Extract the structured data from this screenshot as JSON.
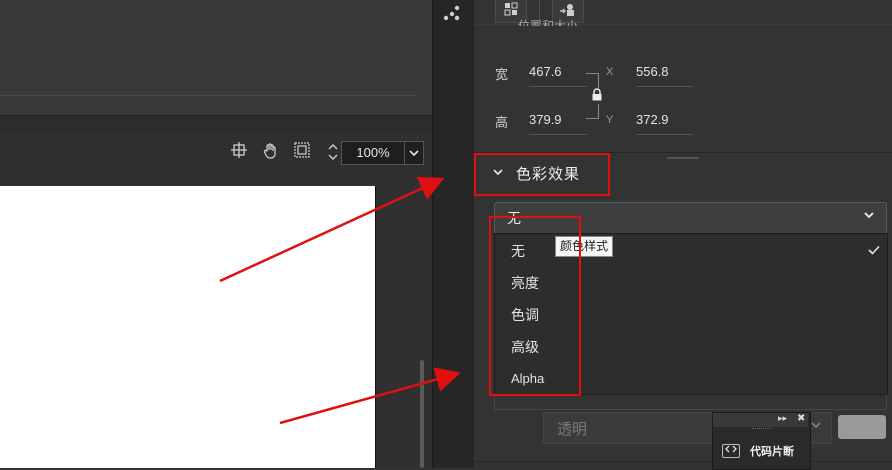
{
  "stage": {
    "zoom_value": "100%",
    "tool_icons": [
      "crosshair-icon",
      "hand-icon",
      "clip-icon",
      "vertical-resize-icon"
    ]
  },
  "properties": {
    "top_buttons": [
      "align-icon",
      "transform-icon"
    ],
    "section_title_partial": "位置和大小",
    "size": {
      "width_label": "宽",
      "width_value": "467.6",
      "height_label": "高",
      "height_value": "379.9",
      "x_label": "X",
      "x_value": "556.8",
      "y_label": "Y",
      "y_value": "372.9"
    },
    "color_effect": {
      "title": "色彩效果",
      "selected": "无",
      "tooltip": "颜色样式",
      "options": [
        "无",
        "亮度",
        "色调",
        "高级",
        "Alpha"
      ],
      "checked_index": 0
    },
    "alpha_placeholder": "透明"
  },
  "snippet_panel": {
    "collapse_glyph": "▸▸",
    "close_glyph": "✖",
    "label": "代码片断"
  },
  "colors": {
    "annotation_red": "#e01010",
    "panel_bg": "#333333",
    "canvas": "#ffffff"
  }
}
